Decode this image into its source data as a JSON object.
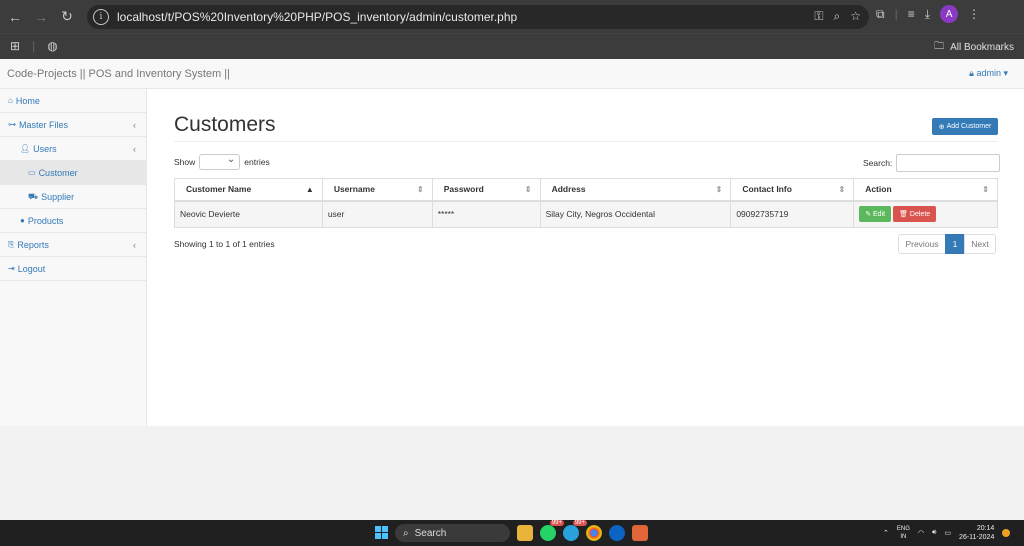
{
  "browser": {
    "url": "localhost/t/POS%20Inventory%20PHP/POS_inventory/admin/customer.php",
    "profile_initial": "A",
    "bookmarks_label": "All Bookmarks"
  },
  "app": {
    "brand": "Code-Projects || POS and Inventory System ||",
    "user_menu": "admin"
  },
  "sidebar": {
    "items": [
      {
        "label": "Home",
        "icon": "home-icon"
      },
      {
        "label": "Master Files",
        "icon": "sitemap-icon"
      },
      {
        "label": "Users",
        "icon": "user-icon"
      },
      {
        "label": "Customer",
        "icon": "card-icon"
      },
      {
        "label": "Supplier",
        "icon": "truck-icon"
      },
      {
        "label": "Products",
        "icon": "product-icon"
      },
      {
        "label": "Reports",
        "icon": "reports-icon"
      },
      {
        "label": "Logout",
        "icon": "logout-icon"
      }
    ]
  },
  "main": {
    "title": "Customers",
    "add_button": "Add Customer",
    "show_label": "Show",
    "entries_label": "entries",
    "search_label": "Search:",
    "columns": [
      "Customer Name",
      "Username",
      "Password",
      "Address",
      "Contact Info",
      "Action"
    ],
    "rows": [
      {
        "name": "Neovic Devierte",
        "username": "user",
        "password": "*****",
        "address": "Silay City, Negros Occidental",
        "contact": "09092735719"
      }
    ],
    "edit_label": "Edit",
    "delete_label": "Delete",
    "info": "Showing 1 to 1 of 1 entries",
    "pager": {
      "prev": "Previous",
      "page": "1",
      "next": "Next"
    }
  },
  "taskbar": {
    "search": "Search",
    "badge_1": "99+",
    "badge_2": "99+",
    "lang_1": "ENG",
    "lang_2": "IN",
    "time": "20:14",
    "date": "26-11-2024"
  },
  "colors": {
    "primary": "#337ab7",
    "success": "#5cb85c",
    "danger": "#d9534f"
  }
}
